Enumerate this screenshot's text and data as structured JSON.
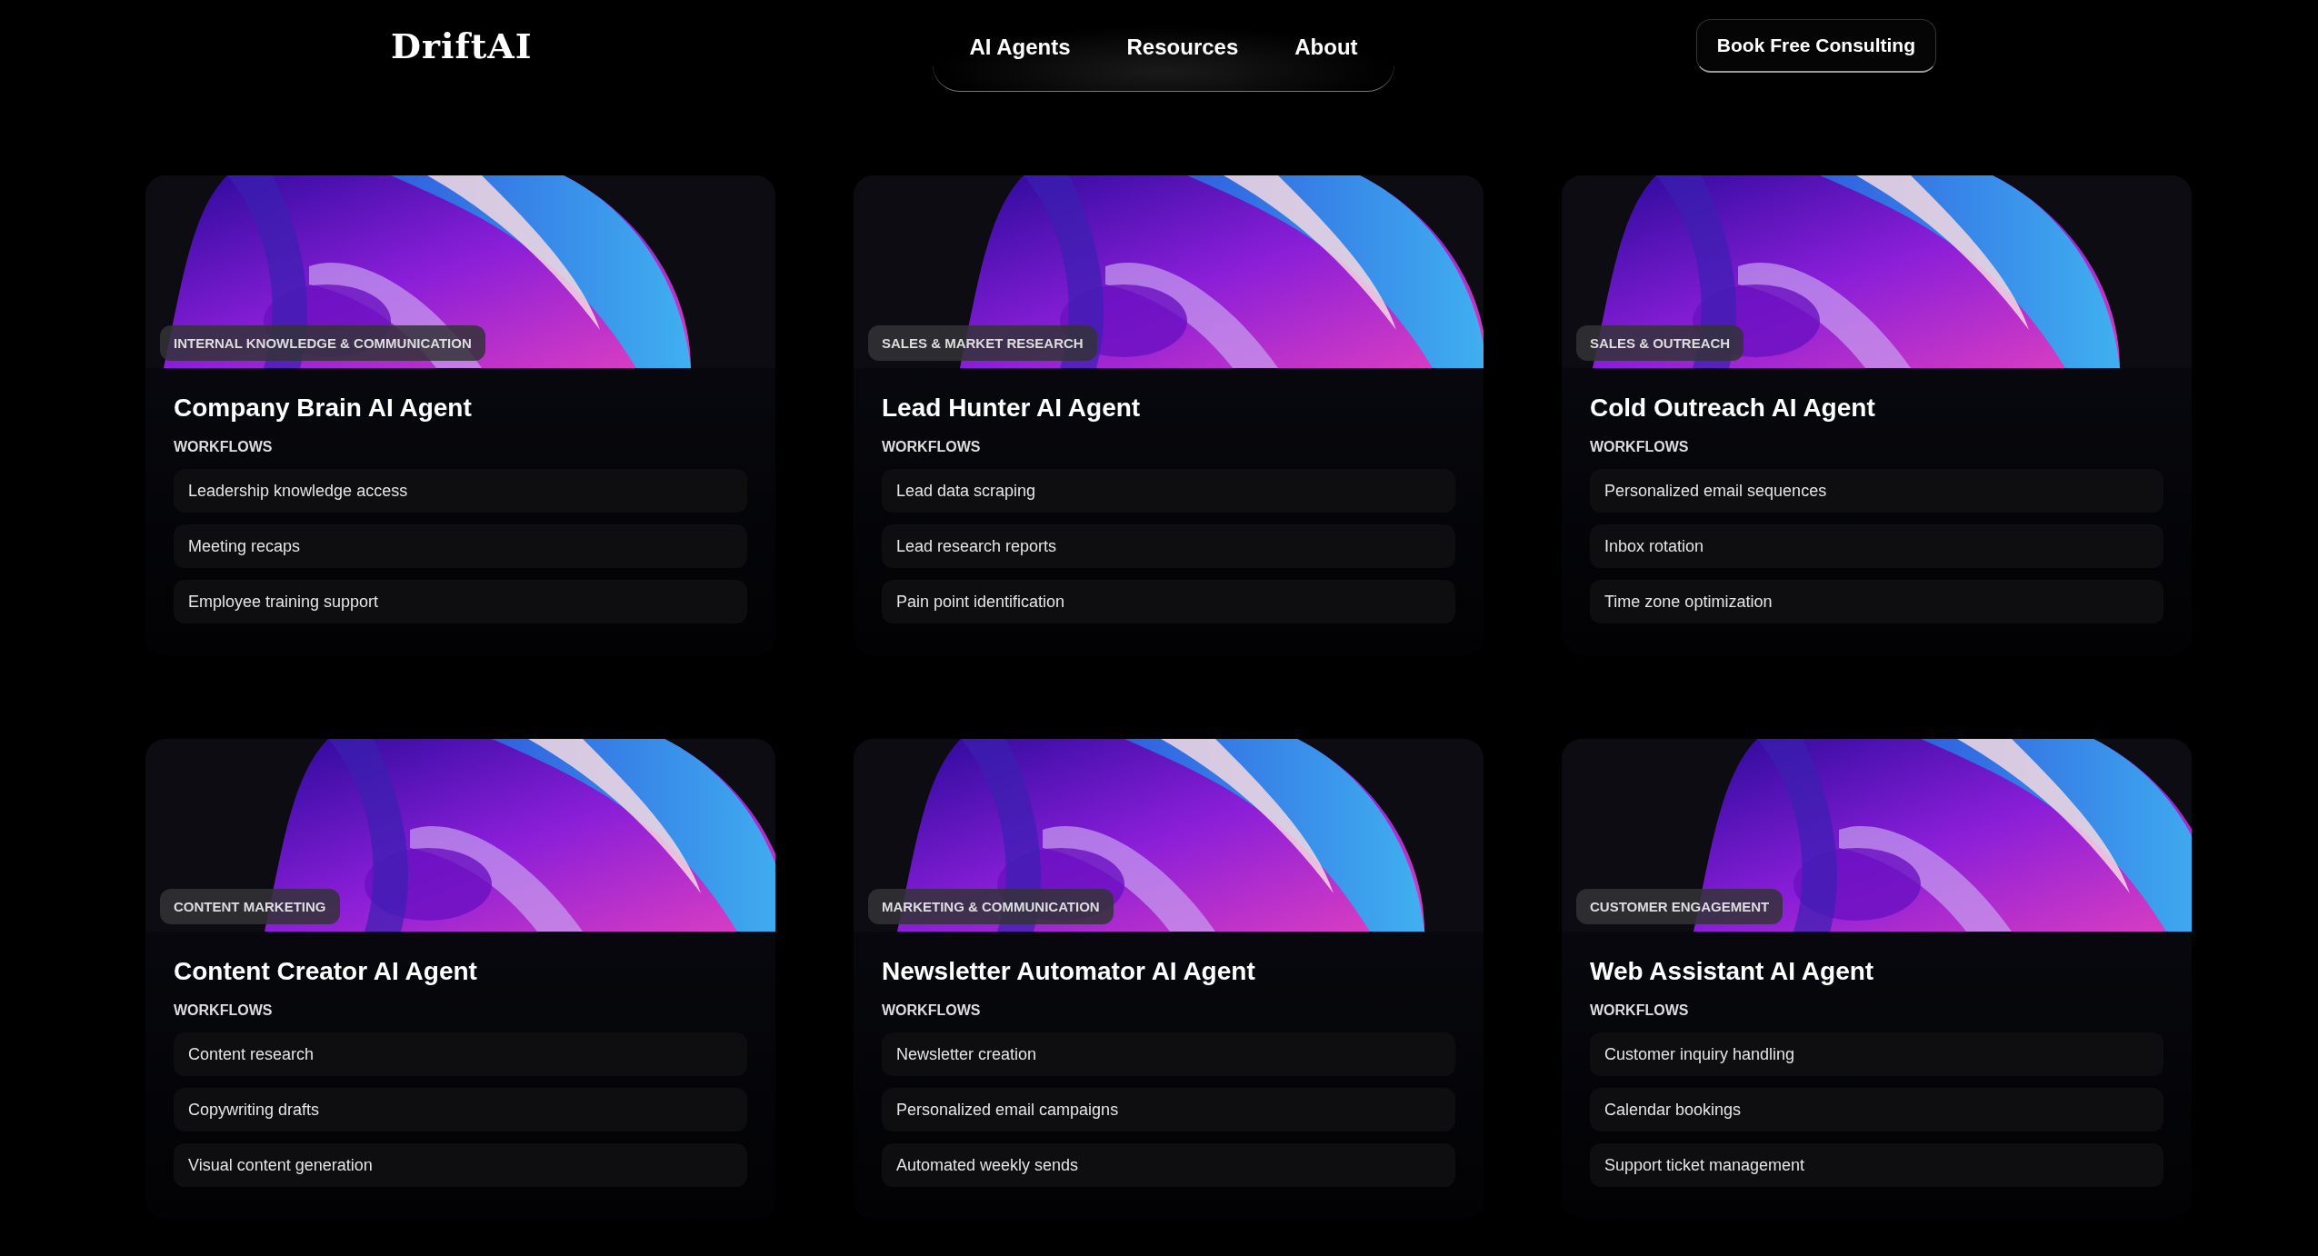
{
  "header": {
    "logo": "DriftAI",
    "nav": [
      {
        "label": "AI Agents"
      },
      {
        "label": "Resources"
      },
      {
        "label": "About"
      }
    ],
    "cta": "Book Free Consulting"
  },
  "agents": [
    {
      "category": "INTERNAL KNOWLEDGE & COMMUNICATION",
      "title": "Company Brain AI Agent",
      "workflows_label": "WORKFLOWS",
      "workflows": [
        "Leadership knowledge access",
        "Meeting recaps",
        "Employee training support"
      ]
    },
    {
      "category": "SALES & MARKET RESEARCH",
      "title": "Lead Hunter AI Agent",
      "workflows_label": "WORKFLOWS",
      "workflows": [
        "Lead data scraping",
        "Lead research reports",
        "Pain point identification"
      ]
    },
    {
      "category": "SALES & OUTREACH",
      "title": "Cold Outreach AI Agent",
      "workflows_label": "WORKFLOWS",
      "workflows": [
        "Personalized email sequences",
        "Inbox rotation",
        "Time zone optimization"
      ]
    },
    {
      "category": "CONTENT MARKETING",
      "title": "Content Creator AI Agent",
      "workflows_label": "WORKFLOWS",
      "workflows": [
        "Content research",
        "Copywriting drafts",
        "Visual content generation"
      ]
    },
    {
      "category": "MARKETING & COMMUNICATION",
      "title": "Newsletter Automator AI Agent",
      "workflows_label": "WORKFLOWS",
      "workflows": [
        "Newsletter creation",
        "Personalized email campaigns",
        "Automated weekly sends"
      ]
    },
    {
      "category": "CUSTOMER ENGAGEMENT",
      "title": "Web Assistant AI Agent",
      "workflows_label": "WORKFLOWS",
      "workflows": [
        "Customer inquiry handling",
        "Calendar bookings",
        "Support ticket management"
      ]
    }
  ]
}
